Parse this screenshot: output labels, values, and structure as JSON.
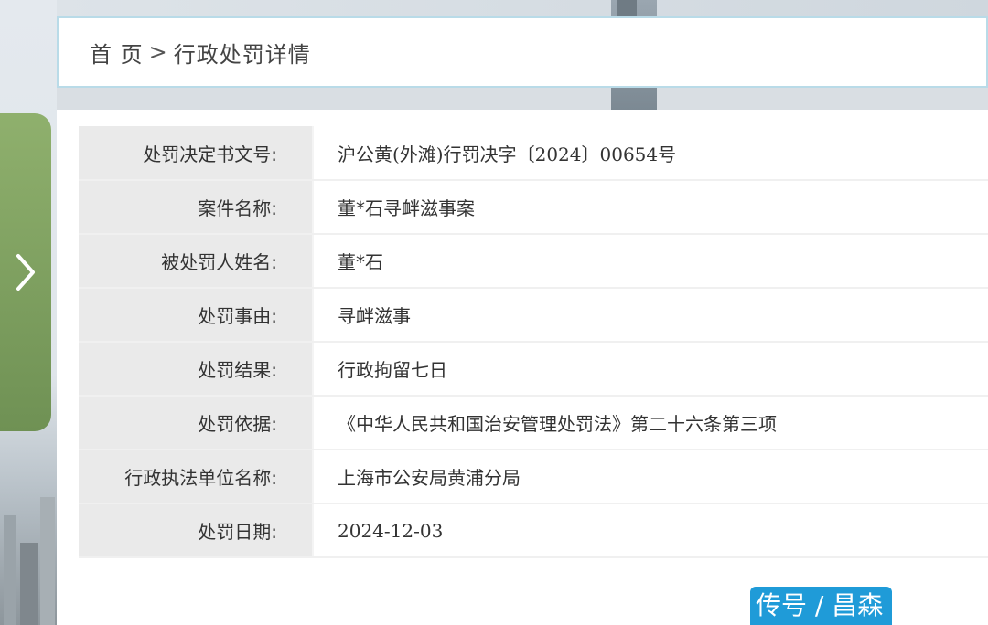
{
  "breadcrumb": {
    "home": "首 页",
    "separator": ">",
    "current": "行政处罚详情"
  },
  "details": [
    {
      "label": "处罚决定书文号:",
      "value": "沪公黄(外滩)行罚决字〔2024〕00654号"
    },
    {
      "label": "案件名称:",
      "value": "董*石寻衅滋事案"
    },
    {
      "label": "被处罚人姓名:",
      "value": "董*石"
    },
    {
      "label": "处罚事由:",
      "value": "寻衅滋事"
    },
    {
      "label": "处罚结果:",
      "value": "行政拘留七日"
    },
    {
      "label": "处罚依据:",
      "value": "《中华人民共和国治安管理处罚法》第二十六条第三项"
    },
    {
      "label": "行政执法单位名称:",
      "value": "上海市公安局黄浦分局"
    },
    {
      "label": "处罚日期:",
      "value": "2024-12-03"
    }
  ],
  "watermark": {
    "text": "传号 / 昌森"
  },
  "icons": {
    "side_handle": "chevron-right-icon"
  },
  "colors": {
    "header_border": "#b9dbe8",
    "label_bg": "#eaeaea",
    "side_handle": "#7fa160",
    "watermark_bg": "#1f9bd8"
  }
}
